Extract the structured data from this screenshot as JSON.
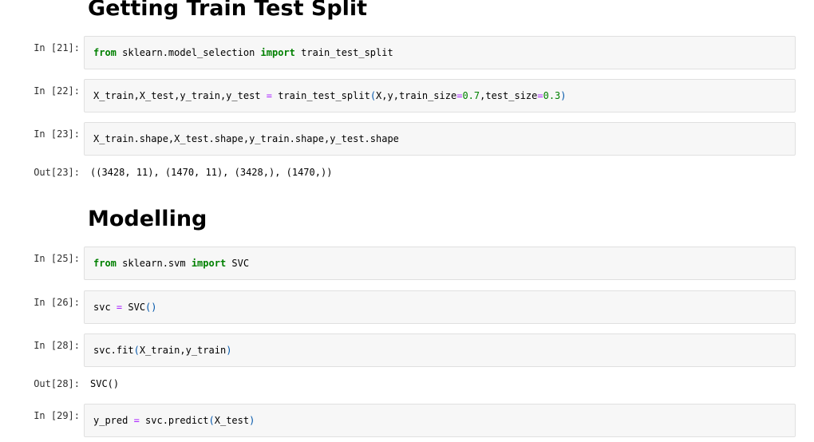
{
  "headings": {
    "split": "Getting Train Test Split",
    "modelling": "Modelling"
  },
  "cells": {
    "c21": {
      "prompt": "In [21]:",
      "kw_from": "from",
      "module": " sklearn.model_selection ",
      "kw_import": "import",
      "name": " train_test_split"
    },
    "c22": {
      "prompt": "In [22]:",
      "lhs": "X_train,X_test,y_train,y_test ",
      "eq": "=",
      "call": " train_test_split",
      "open": "(",
      "args1": "X,y,train_size",
      "eq2": "=",
      "num1": "0.7",
      "args2": ",test_size",
      "eq3": "=",
      "num2": "0.3",
      "close": ")"
    },
    "c23": {
      "prompt": "In [23]:",
      "code": "X_train.shape,X_test.shape,y_train.shape,y_test.shape",
      "out_prompt": "Out[23]:",
      "output": "((3428, 11), (1470, 11), (3428,), (1470,))"
    },
    "c25": {
      "prompt": "In [25]:",
      "kw_from": "from",
      "module": " sklearn.svm ",
      "kw_import": "import",
      "name": " SVC"
    },
    "c26": {
      "prompt": "In [26]:",
      "lhs": "svc ",
      "eq": "=",
      "call": " SVC",
      "parens": "()"
    },
    "c28": {
      "prompt": "In [28]:",
      "call": "svc.fit",
      "open": "(",
      "args": "X_train,y_train",
      "close": ")",
      "out_prompt": "Out[28]:",
      "output": "SVC()"
    },
    "c29": {
      "prompt": "In [29]:",
      "lhs": "y_pred ",
      "eq": "=",
      "call": " svc.predict",
      "open": "(",
      "args": "X_test",
      "close": ")"
    }
  }
}
